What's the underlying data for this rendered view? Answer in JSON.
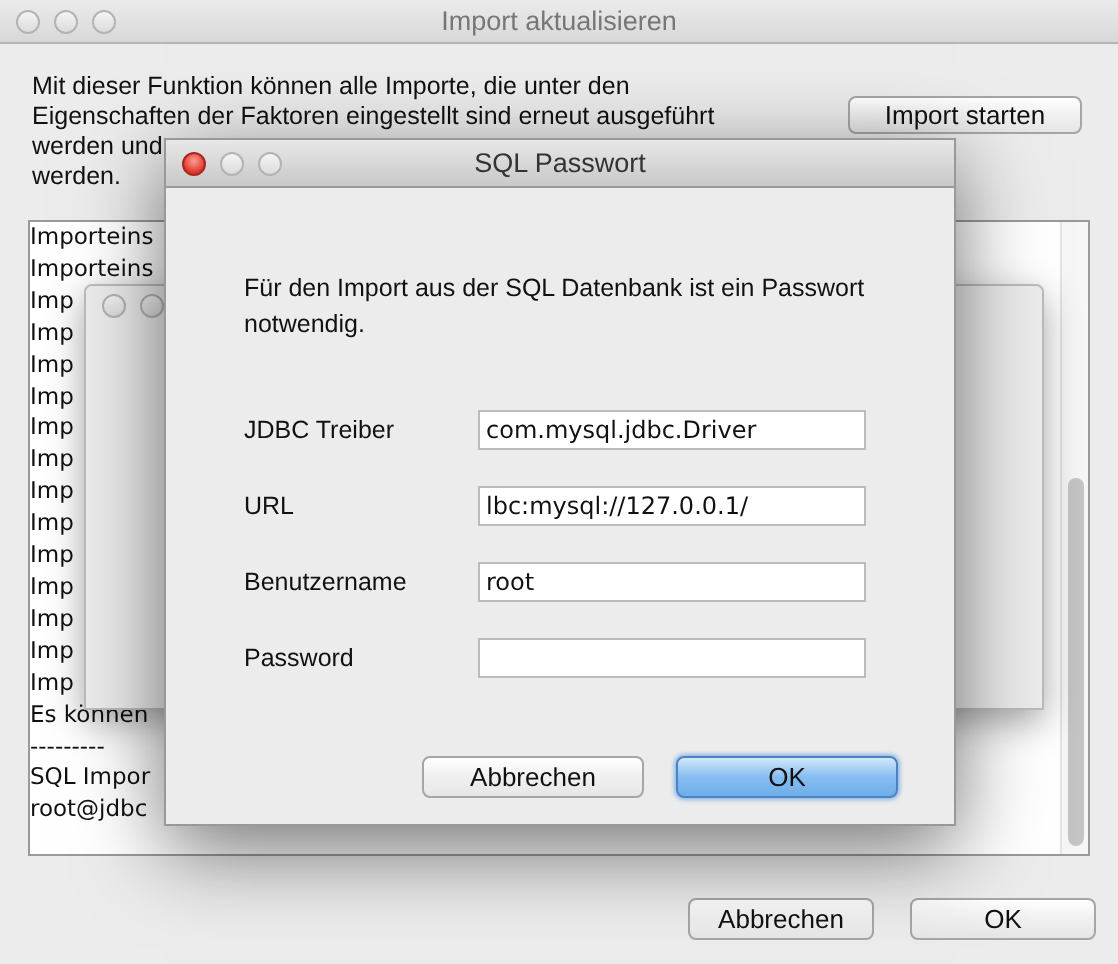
{
  "main_window": {
    "title": "Import aktualisieren",
    "active": false,
    "description": [
      "Mit dieser Funktion können alle Importe, die unter den",
      "Eigenschaften der Faktoren eingestellt sind erneut ausgeführt",
      "werden und",
      "werden."
    ],
    "import_button": "Import starten",
    "log_lines": [
      "Importeins",
      "Importeins",
      "Imp",
      "Imp",
      "Imp",
      "Imp",
      "Imp",
      "Imp",
      "Imp",
      "Imp",
      "Imp",
      "Imp",
      "Imp",
      "Imp",
      "Imp",
      "Es können",
      "---------",
      "SQL Impor",
      "root@jdbc"
    ],
    "buttons": [
      {
        "label": "Abbrechen",
        "default": false
      },
      {
        "label": "OK",
        "default": false
      }
    ]
  },
  "background_window": {
    "active": false
  },
  "dialog": {
    "title": "SQL Passwort",
    "active": true,
    "message": "Für den Import aus der SQL Datenbank ist ein Passwort notwendig.",
    "fields": [
      {
        "label": "JDBC Treiber",
        "value": "com.mysql.jdbc.Driver"
      },
      {
        "label": "URL",
        "value": "lbc:mysql://127.0.0.1/"
      },
      {
        "label": "Benutzername",
        "value": "root"
      },
      {
        "label": "Password"
      }
    ],
    "buttons": [
      {
        "label": "Abbrechen",
        "default": false
      },
      {
        "label": "OK",
        "default": true
      }
    ]
  }
}
